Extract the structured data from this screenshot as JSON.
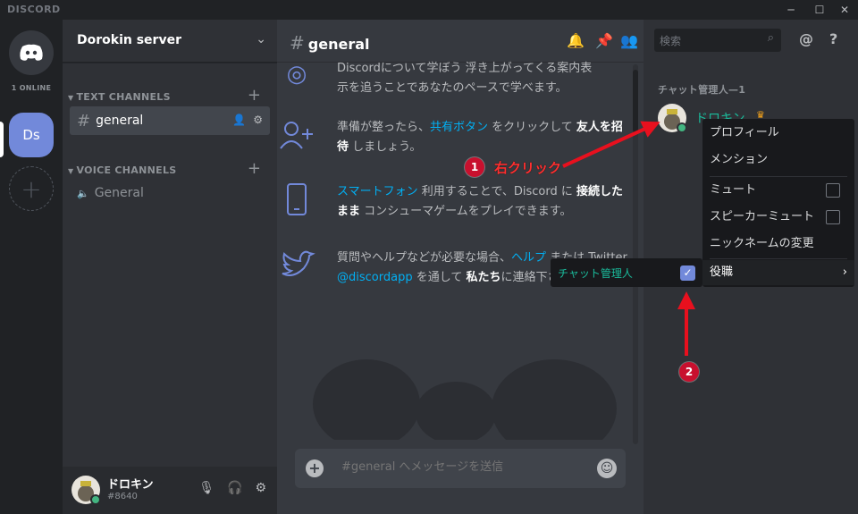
{
  "app": {
    "brand": "DISCORD"
  },
  "window": {
    "min": "—",
    "max": "☐",
    "close": "✕"
  },
  "rail": {
    "online_label": "1 ONLINE",
    "server_abbr": "Ds",
    "add": "+"
  },
  "server": {
    "name": "Dorokin server"
  },
  "categories": {
    "text": "TEXT CHANNELS",
    "voice": "VOICE CHANNELS"
  },
  "channels": {
    "text": [
      {
        "name": "general",
        "hash": "#"
      }
    ],
    "voice": [
      {
        "name": "General"
      }
    ]
  },
  "user": {
    "name": "ドロキン",
    "tag": "#8640"
  },
  "chat": {
    "channel": "general",
    "hash": "#",
    "composer_placeholder": "#general へメッセージを送信",
    "tips": [
      {
        "text_a": "Discordについて学ぼう 浮き上がってくる案内表",
        "text_b": "示を追うことであなたのペースで学べます。"
      },
      {
        "pre": "準備が整ったら、",
        "link": "共有ボタン",
        "mid": " をクリックして ",
        "bold": "友人を招待",
        "post": " しましょう。"
      },
      {
        "link": "スマートフォン",
        "mid": " 利用することで、Discord に ",
        "bold": "接続したまま",
        "post": " コンシューマゲームをプレイできます。"
      },
      {
        "pre": "質問やヘルプなどが必要な場合、",
        "link": "ヘルプ",
        "mid": " または Twitter ",
        "link2": "@discordapp",
        "mid2": " を通して ",
        "bold": "私たち",
        "post": "に連絡下さい。"
      }
    ]
  },
  "members": {
    "search_placeholder": "検索",
    "role_header": "チャット管理人—1",
    "member_name": "ドロキン"
  },
  "context_menu": {
    "profile": "プロフィール",
    "mention": "メンション",
    "mute": "ミュート",
    "speaker_mute": "スピーカーミュート",
    "nickname": "ニックネームの変更",
    "roles": "役職"
  },
  "submenu": {
    "role_name": "チャット管理人",
    "checked": true
  },
  "annotations": {
    "step1": "1",
    "step1_label": "右クリック",
    "step2": "2"
  },
  "colors": {
    "accent": "#7289da",
    "role": "#1abc9c",
    "annotation": "#c8102e"
  }
}
